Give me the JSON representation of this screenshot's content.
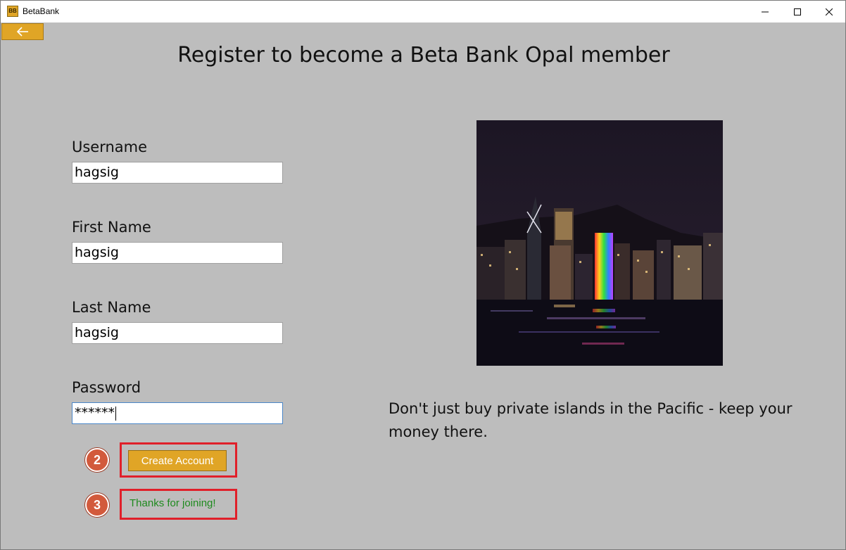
{
  "window": {
    "title": "BetaBank",
    "icon": "betabank-app-icon",
    "icon_text": "BB",
    "controls": [
      "minimize-icon",
      "maximize-icon",
      "close-icon"
    ]
  },
  "nav": {
    "back_icon": "arrow-left-icon",
    "accent_color": "#e0a526"
  },
  "page": {
    "title": "Register to become a Beta Bank Opal member"
  },
  "form": {
    "username": {
      "label": "Username",
      "value": "hagsig"
    },
    "first_name": {
      "label": "First Name",
      "value": "hagsig"
    },
    "last_name": {
      "label": "Last Name",
      "value": "hagsig"
    },
    "password": {
      "label": "Password",
      "value": "******"
    },
    "create_button_label": "Create Account",
    "status_message": "Thanks for joining!",
    "status_color": "#1e8a1e"
  },
  "promo": {
    "image": "city-night-skyline-photo",
    "tagline": "Don't just buy private islands in the Pacific - keep your money there."
  },
  "annotations": [
    {
      "number": "2",
      "target": "create-account-button",
      "color": "#e0202a"
    },
    {
      "number": "3",
      "target": "status-message",
      "color": "#e0202a"
    }
  ]
}
